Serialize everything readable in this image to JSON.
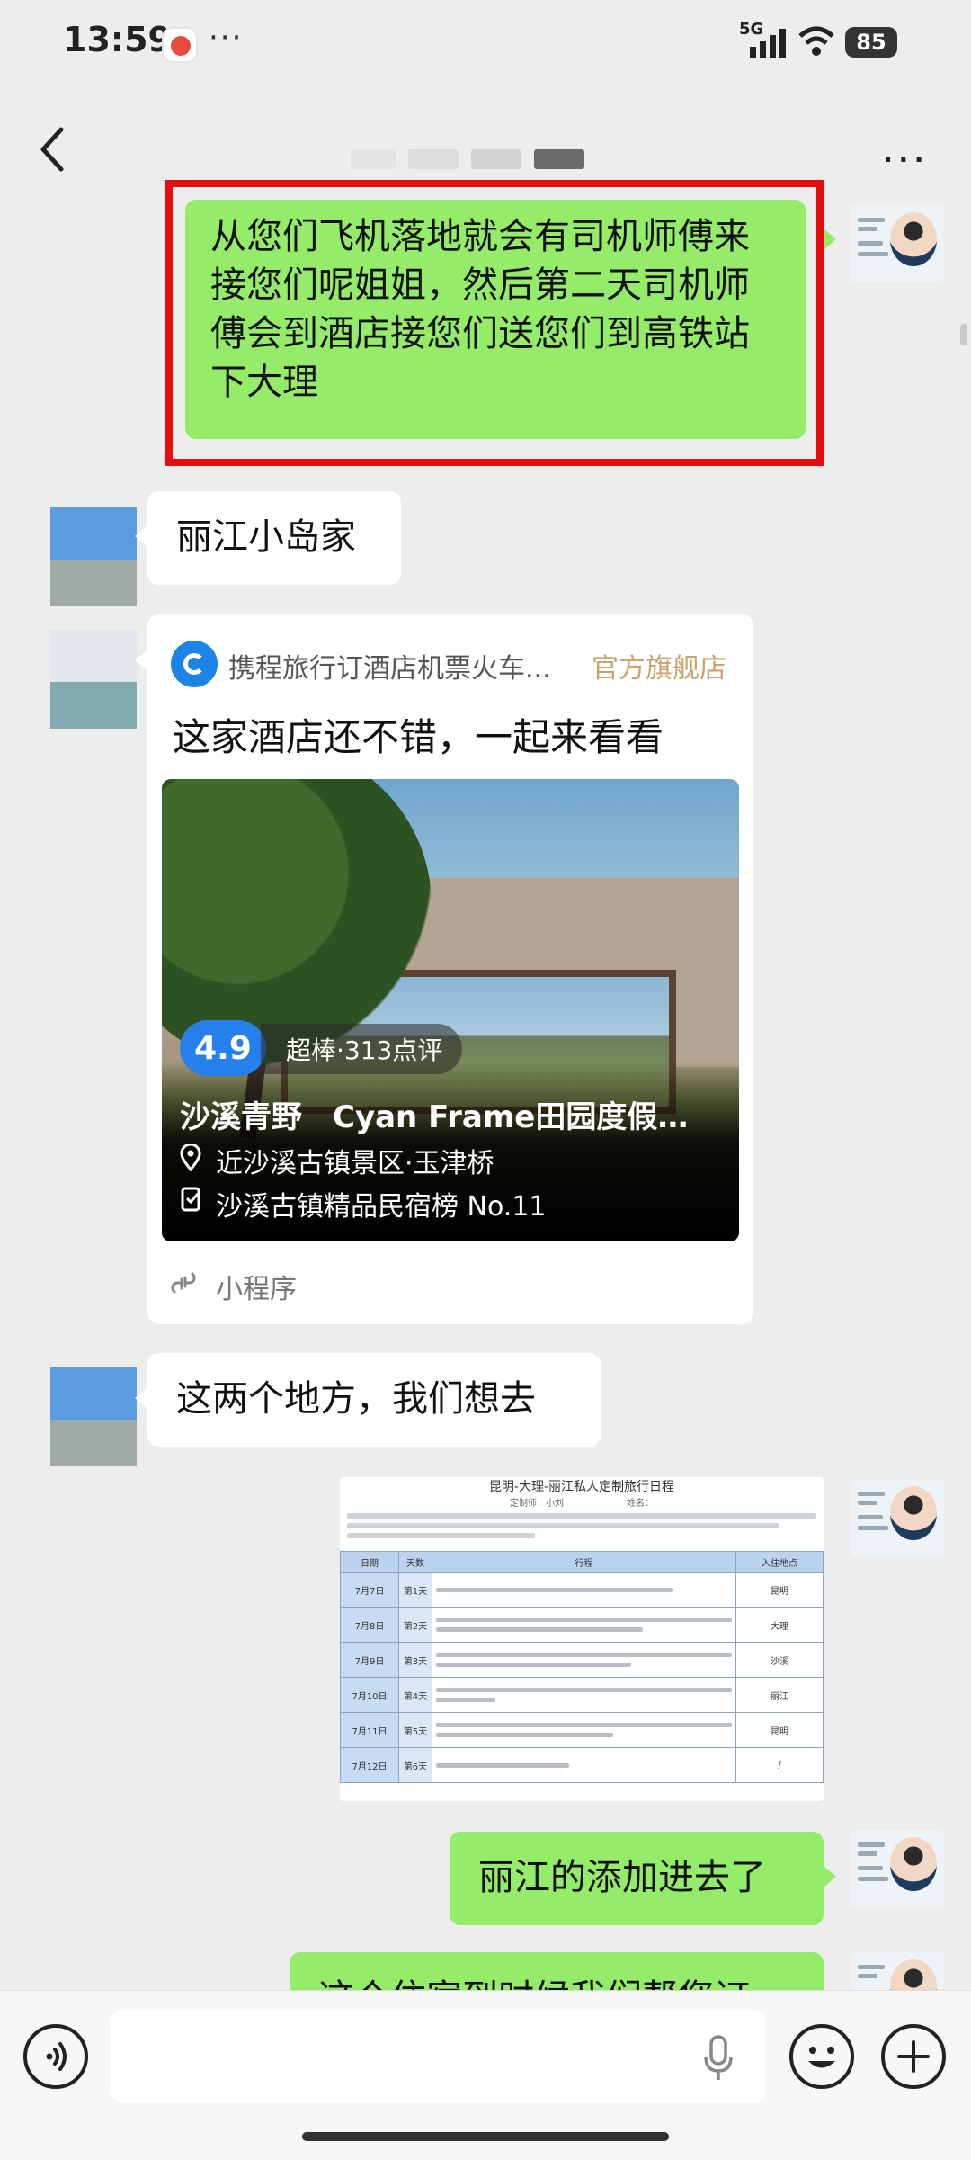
{
  "status_bar": {
    "time": "13:59",
    "overflow": "···",
    "network": "5G",
    "battery": "85"
  },
  "nav": {
    "more": "···"
  },
  "messages": {
    "m1": "从您们飞机落地就会有司机师傅来接您们呢姐姐，然后第二天司机师傅会到酒店接您们送您们到高铁站下大理",
    "m2": "丽江小岛家",
    "m4": "这两个地方，我们想去",
    "m6": "丽江的添加进去了",
    "m7": "这个住宿到时候我们帮您订"
  },
  "mini_card": {
    "source": "携程旅行订酒店机票火车...",
    "flag": "官方旗舰店",
    "title": "这家酒店还不错，一起来看看",
    "rating": "4.9",
    "rating_text": "超棒·313点评",
    "hotel": "沙溪青野　Cyan Frame田园度假民...",
    "location": "近沙溪古镇景区·玉津桥",
    "ranking": "沙溪古镇精品民宿榜 No.11",
    "footer": "小程序"
  },
  "itinerary": {
    "title": "昆明-大理-丽江私人定制旅行日程",
    "subtitle": "定制师：小刘　　　　　　　姓名：",
    "header": [
      "日期",
      "天数",
      "行程",
      "入住地点"
    ],
    "rows": [
      {
        "date": "7月7日",
        "day": "第1天",
        "city": "昆明"
      },
      {
        "date": "7月8日",
        "day": "第2天",
        "city": "大理"
      },
      {
        "date": "7月9日",
        "day": "第3天",
        "city": "沙溪"
      },
      {
        "date": "7月10日",
        "day": "第4天",
        "city": "丽江"
      },
      {
        "date": "7月11日",
        "day": "第5天",
        "city": "昆明"
      },
      {
        "date": "7月12日",
        "day": "第6天",
        "city": "/"
      }
    ]
  },
  "icons": {
    "back": "chevron-left-icon",
    "more": "more-dots-icon",
    "voice": "voice-icon",
    "mic": "mic-icon",
    "emoji": "emoji-icon",
    "plus": "plus-icon"
  },
  "colors": {
    "sent_bubble": "#95ec69",
    "received_bubble": "#ffffff",
    "highlight_frame": "#e50d0d",
    "rating_badge": "#2680eb",
    "official_flag": "#c9a36b"
  }
}
